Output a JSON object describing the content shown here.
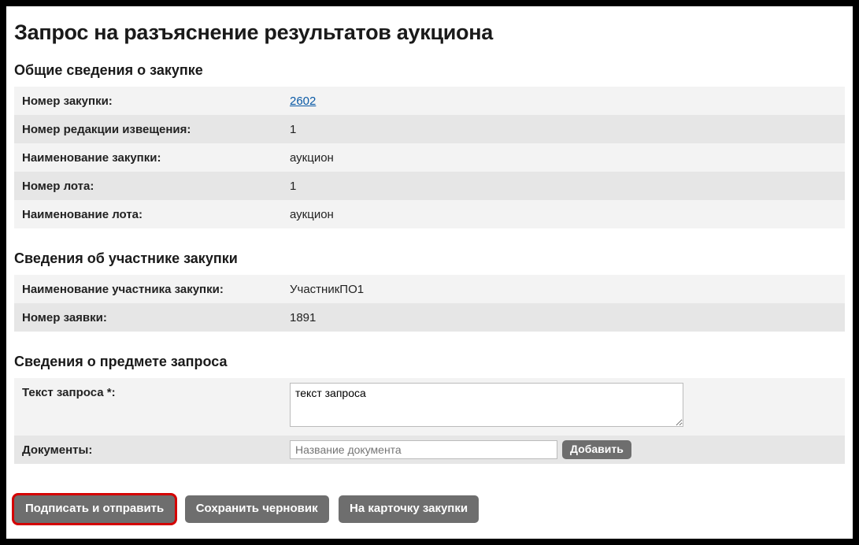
{
  "page_title": "Запрос на разъяснение результатов аукциона",
  "sections": {
    "general": {
      "title": "Общие сведения о закупке",
      "rows": {
        "purchase_number_label": "Номер закупки:",
        "purchase_number_value": "2602",
        "notice_revision_label": "Номер редакции извещения:",
        "notice_revision_value": "1",
        "purchase_name_label": "Наименование закупки:",
        "purchase_name_value": "аукцион",
        "lot_number_label": "Номер лота:",
        "lot_number_value": "1",
        "lot_name_label": "Наименование лота:",
        "lot_name_value": "аукцион"
      }
    },
    "participant": {
      "title": "Сведения об участнике закупки",
      "rows": {
        "participant_name_label": "Наименование участника закупки:",
        "participant_name_value": "УчастникПО1",
        "application_number_label": "Номер заявки:",
        "application_number_value": "1891"
      }
    },
    "subject": {
      "title": "Сведения о предмете запроса",
      "request_text_label": "Текст запроса *:",
      "request_text_value": "текст запроса",
      "documents_label": "Документы:",
      "documents_placeholder": "Название документа",
      "add_button": "Добавить"
    }
  },
  "buttons": {
    "sign_send": "Подписать и отправить",
    "save_draft": "Сохранить черновик",
    "to_card": "На карточку закупки"
  }
}
